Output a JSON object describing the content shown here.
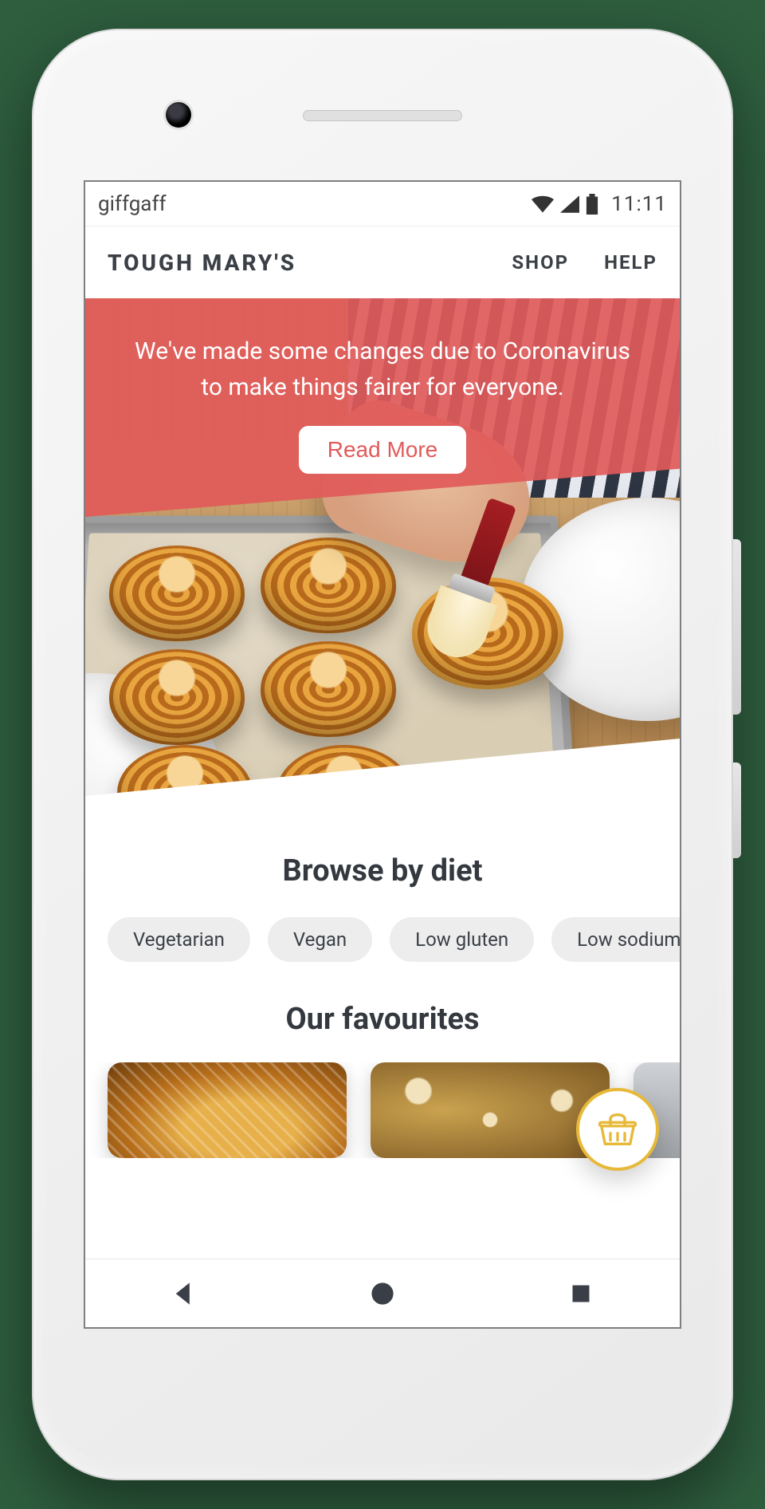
{
  "statusbar": {
    "carrier": "giffgaff",
    "time": "11:11"
  },
  "header": {
    "brand": "TOUGH MARY'S",
    "nav": {
      "shop": "SHOP",
      "help": "HELP"
    }
  },
  "banner": {
    "line1": "We've made some changes due to Coronavirus",
    "line2": "to make things fairer for everyone.",
    "cta": "Read More"
  },
  "diet": {
    "heading": "Browse by diet",
    "chips": [
      "Vegetarian",
      "Vegan",
      "Low gluten",
      "Low sodium"
    ]
  },
  "favourites": {
    "heading": "Our favourites"
  },
  "colors": {
    "accent_red": "#e15a5a",
    "accent_gold": "#e7b93a",
    "text": "#34383f",
    "chip_bg": "#ededed"
  }
}
